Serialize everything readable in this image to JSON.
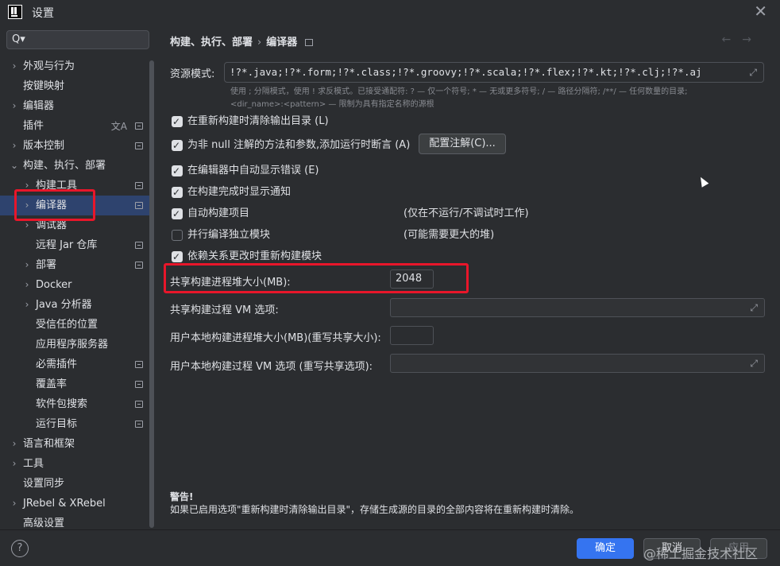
{
  "window": {
    "title": "设置",
    "close_glyph": "✕"
  },
  "search": {
    "placeholder": "",
    "icon_glyph": "Q▾"
  },
  "sidebar": {
    "items": [
      {
        "label": "外观与行为",
        "expandable": true
      },
      {
        "label": "按键映射",
        "expandable": false
      },
      {
        "label": "编辑器",
        "expandable": true
      },
      {
        "label": "插件",
        "expandable": false,
        "lang_icon": "文A",
        "badge": true
      },
      {
        "label": "版本控制",
        "expandable": true,
        "badge": true
      },
      {
        "label": "构建、执行、部署",
        "expandable": true,
        "expanded": true
      },
      {
        "label": "构建工具",
        "expandable": true,
        "indent": 1,
        "badge": true
      },
      {
        "label": "编译器",
        "expandable": true,
        "indent": 1,
        "badge": true,
        "selected": true
      },
      {
        "label": "调试器",
        "expandable": true,
        "indent": 1
      },
      {
        "label": "远程 Jar 仓库",
        "expandable": false,
        "indent": 1,
        "badge": true
      },
      {
        "label": "部署",
        "expandable": true,
        "indent": 1,
        "badge": true
      },
      {
        "label": "Docker",
        "expandable": true,
        "indent": 1
      },
      {
        "label": "Java 分析器",
        "expandable": true,
        "indent": 1
      },
      {
        "label": "受信任的位置",
        "expandable": false,
        "indent": 1
      },
      {
        "label": "应用程序服务器",
        "expandable": false,
        "indent": 1
      },
      {
        "label": "必需插件",
        "expandable": false,
        "indent": 1,
        "badge": true
      },
      {
        "label": "覆盖率",
        "expandable": false,
        "indent": 1,
        "badge": true
      },
      {
        "label": "软件包搜索",
        "expandable": false,
        "indent": 1,
        "badge": true
      },
      {
        "label": "运行目标",
        "expandable": false,
        "indent": 1,
        "badge": true
      },
      {
        "label": "语言和框架",
        "expandable": true
      },
      {
        "label": "工具",
        "expandable": true
      },
      {
        "label": "设置同步",
        "expandable": false
      },
      {
        "label": "JRebel & XRebel",
        "expandable": true
      },
      {
        "label": "高级设置",
        "expandable": false
      }
    ]
  },
  "main": {
    "breadcrumb": {
      "parent": "构建、执行、部署",
      "separator": "›",
      "current": "编译器"
    },
    "nav": {
      "back": "←",
      "forward": "→"
    },
    "resource_patterns": {
      "label": "资源模式:",
      "value": "!?*.java;!?*.form;!?*.class;!?*.groovy;!?*.scala;!?*.flex;!?*.kt;!?*.clj;!?*.aj",
      "hint_line1": "使用 ; 分隔模式，使用 ! 求反模式。已接受通配符: ? — 仅一个符号; * — 无或更多符号; / — 路径分隔符; /**/ — 任何数量的目录;",
      "hint_line2": "<dir_name>:<pattern> — 限制为具有指定名称的源根"
    },
    "checkboxes": [
      {
        "label": "在重新构建时清除输出目录 (L)",
        "checked": true
      },
      {
        "label": "为非 null 注解的方法和参数,添加运行时断言 (A)",
        "checked": true
      },
      {
        "label": "在编辑器中自动显示错误 (E)",
        "checked": true
      },
      {
        "label": "在构建完成时显示通知",
        "checked": true
      },
      {
        "label": "自动构建项目",
        "checked": true,
        "note": "(仅在不运行/不调试时工作)"
      },
      {
        "label": "并行编译独立模块",
        "checked": false,
        "note": "(可能需要更大的堆)"
      },
      {
        "label": "依赖关系更改时重新构建模块",
        "checked": true
      }
    ],
    "configure_annotations_button": "配置注解(C)...",
    "fields": {
      "shared_heap": {
        "label": "共享构建进程堆大小(MB):",
        "value": "2048"
      },
      "shared_vm": {
        "label": "共享构建过程 VM 选项:",
        "value": ""
      },
      "user_heap": {
        "label": "用户本地构建进程堆大小(MB)(重写共享大小):",
        "value": ""
      },
      "user_vm": {
        "label": "用户本地构建过程 VM 选项 (重写共享选项):",
        "value": ""
      }
    },
    "warning": {
      "title": "警告!",
      "text": "如果已启用选项\"重新构建时清除输出目录\"，存储生成源的目录的全部内容将在重新构建时清除。"
    }
  },
  "footer": {
    "help": "?",
    "ok": "确定",
    "cancel": "取消",
    "apply": "应用",
    "watermark": "@稀土掘金技术社区"
  },
  "colors": {
    "accent": "#3574f0",
    "selected": "#2e436e",
    "highlight": "#e8162a",
    "bg": "#2b2d30"
  }
}
